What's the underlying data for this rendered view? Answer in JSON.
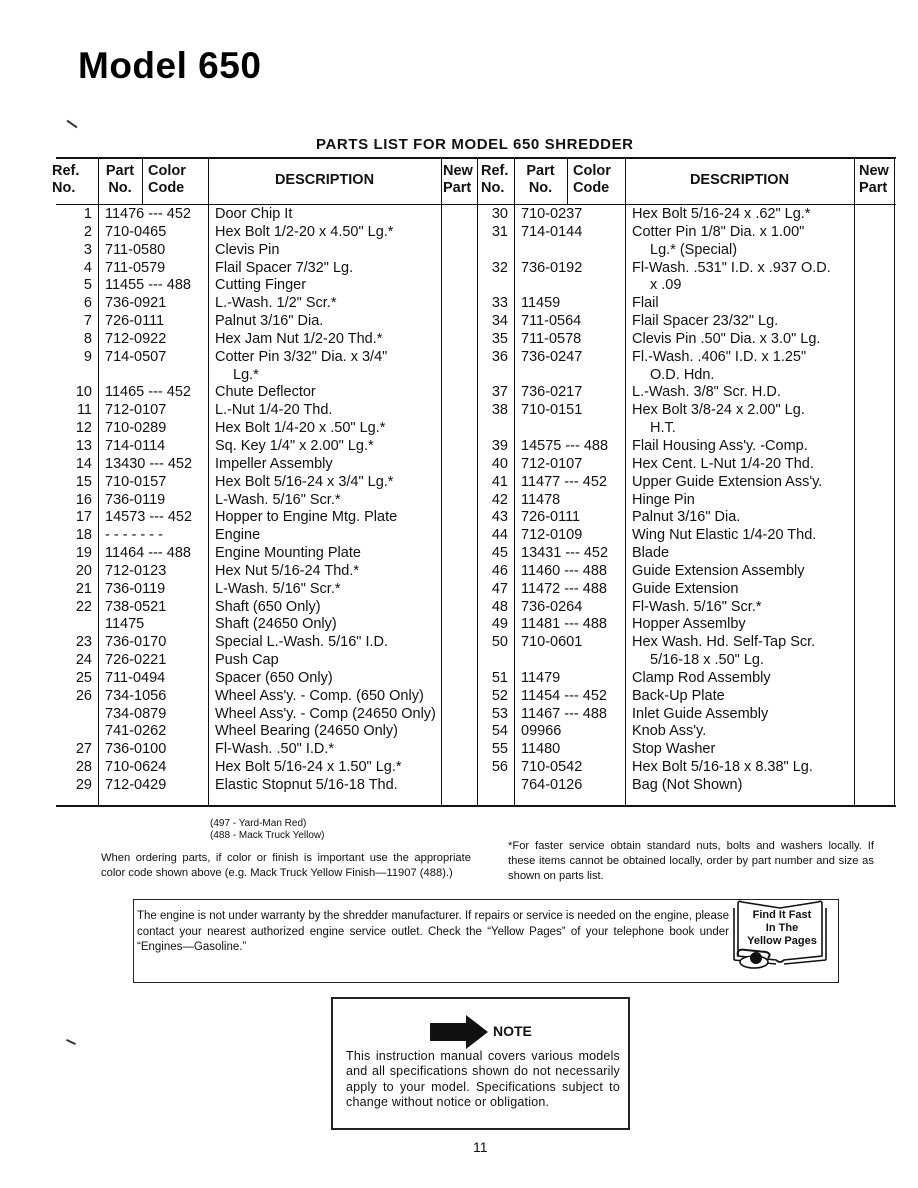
{
  "page": {
    "title": "Model 650",
    "parts_heading": "PARTS LIST FOR MODEL 650 SHREDDER",
    "page_number": "11"
  },
  "table": {
    "headers": {
      "ref": [
        "Ref.",
        "No."
      ],
      "part": [
        "Part",
        "No."
      ],
      "color": [
        "Color",
        "Code"
      ],
      "description": "DESCRIPTION",
      "new": [
        "New",
        "Part"
      ]
    },
    "left_rows": [
      {
        "ref": "1",
        "part": "11476 --- 452",
        "desc": "Door Chip It"
      },
      {
        "ref": "2",
        "part": "710-0465",
        "desc": "Hex Bolt 1/2-20 x 4.50\" Lg.*"
      },
      {
        "ref": "3",
        "part": "711-0580",
        "desc": "Clevis Pin"
      },
      {
        "ref": "4",
        "part": "711-0579",
        "desc": "Flail Spacer 7/32\" Lg."
      },
      {
        "ref": "5",
        "part": "11455 --- 488",
        "desc": "Cutting Finger"
      },
      {
        "ref": "6",
        "part": "736-0921",
        "desc": "L.-Wash. 1/2\" Scr.*"
      },
      {
        "ref": "7",
        "part": "726-0111",
        "desc": "Palnut 3/16\" Dia."
      },
      {
        "ref": "8",
        "part": "712-0922",
        "desc": "Hex Jam Nut 1/2-20 Thd.*"
      },
      {
        "ref": "9",
        "part": "714-0507",
        "desc": "Cotter Pin 3/32\" Dia. x 3/4\""
      },
      {
        "ref": "",
        "part": "",
        "desc": "Lg.*",
        "cont": true
      },
      {
        "ref": "10",
        "part": "11465 --- 452",
        "desc": "Chute Deflector"
      },
      {
        "ref": "11",
        "part": "712-0107",
        "desc": "L.-Nut 1/4-20 Thd."
      },
      {
        "ref": "12",
        "part": "710-0289",
        "desc": "Hex Bolt 1/4-20 x .50\" Lg.*"
      },
      {
        "ref": "13",
        "part": "714-0114",
        "desc": "Sq. Key 1/4\" x 2.00\" Lg.*"
      },
      {
        "ref": "14",
        "part": "13430 --- 452",
        "desc": "Impeller Assembly"
      },
      {
        "ref": "15",
        "part": "710-0157",
        "desc": "Hex Bolt 5/16-24 x 3/4\" Lg.*"
      },
      {
        "ref": "16",
        "part": "736-0119",
        "desc": "L-Wash. 5/16\" Scr.*"
      },
      {
        "ref": "17",
        "part": "14573 --- 452",
        "desc": "Hopper to Engine Mtg. Plate"
      },
      {
        "ref": "18",
        "part": "- - - - - - -",
        "desc": "Engine"
      },
      {
        "ref": "19",
        "part": "11464 --- 488",
        "desc": "Engine Mounting Plate"
      },
      {
        "ref": "20",
        "part": "712-0123",
        "desc": "Hex Nut 5/16-24 Thd.*"
      },
      {
        "ref": "21",
        "part": "736-0119",
        "desc": "L-Wash. 5/16\" Scr.*"
      },
      {
        "ref": "22",
        "part": "738-0521",
        "desc": "Shaft (650 Only)"
      },
      {
        "ref": "",
        "part": "11475",
        "desc": "Shaft (24650 Only)"
      },
      {
        "ref": "23",
        "part": "736-0170",
        "desc": "Special L.-Wash. 5/16\" I.D."
      },
      {
        "ref": "24",
        "part": "726-0221",
        "desc": "Push Cap"
      },
      {
        "ref": "25",
        "part": "711-0494",
        "desc": "Spacer (650 Only)"
      },
      {
        "ref": "26",
        "part": "734-1056",
        "desc": "Wheel Ass'y. - Comp. (650 Only)"
      },
      {
        "ref": "",
        "part": "734-0879",
        "desc": "Wheel Ass'y. - Comp (24650 Only)"
      },
      {
        "ref": "",
        "part": "741-0262",
        "desc": "Wheel Bearing (24650 Only)"
      },
      {
        "ref": "27",
        "part": "736-0100",
        "desc": "Fl-Wash. .50\" I.D.*"
      },
      {
        "ref": "28",
        "part": "710-0624",
        "desc": "Hex Bolt  5/16-24 x 1.50\" Lg.*"
      },
      {
        "ref": "29",
        "part": "712-0429",
        "desc": "Elastic Stopnut 5/16-18 Thd."
      }
    ],
    "right_rows": [
      {
        "ref": "30",
        "part": "710-0237",
        "desc": "Hex Bolt 5/16-24 x .62\" Lg.*"
      },
      {
        "ref": "31",
        "part": "714-0144",
        "desc": "Cotter Pin 1/8\" Dia. x 1.00\""
      },
      {
        "ref": "",
        "part": "",
        "desc": "Lg.* (Special)",
        "cont": true
      },
      {
        "ref": "32",
        "part": "736-0192",
        "desc": "Fl-Wash. .531\" I.D. x .937 O.D."
      },
      {
        "ref": "",
        "part": "",
        "desc": "x .09",
        "cont": true
      },
      {
        "ref": "33",
        "part": "11459",
        "desc": "Flail"
      },
      {
        "ref": "34",
        "part": "711-0564",
        "desc": "Flail Spacer 23/32\" Lg."
      },
      {
        "ref": "35",
        "part": "711-0578",
        "desc": "Clevis Pin .50\" Dia. x 3.0\" Lg."
      },
      {
        "ref": "36",
        "part": "736-0247",
        "desc": "Fl.-Wash. .406\" I.D. x 1.25\""
      },
      {
        "ref": "",
        "part": "",
        "desc": "O.D. Hdn.",
        "cont": true
      },
      {
        "ref": "37",
        "part": "736-0217",
        "desc": "L.-Wash. 3/8\" Scr. H.D."
      },
      {
        "ref": "38",
        "part": "710-0151",
        "desc": "Hex Bolt 3/8-24 x 2.00\" Lg."
      },
      {
        "ref": "",
        "part": "",
        "desc": "H.T.",
        "cont": true
      },
      {
        "ref": "39",
        "part": "14575 --- 488",
        "desc": "Flail Housing Ass'y. -Comp."
      },
      {
        "ref": "40",
        "part": "712-0107",
        "desc": "Hex Cent. L-Nut 1/4-20 Thd."
      },
      {
        "ref": "41",
        "part": "11477 --- 452",
        "desc": "Upper Guide Extension Ass'y."
      },
      {
        "ref": "42",
        "part": "11478",
        "desc": "Hinge Pin"
      },
      {
        "ref": "43",
        "part": "726-0111",
        "desc": "Palnut 3/16\" Dia."
      },
      {
        "ref": "44",
        "part": "712-0109",
        "desc": "Wing Nut Elastic 1/4-20 Thd."
      },
      {
        "ref": "45",
        "part": "13431 --- 452",
        "desc": "Blade"
      },
      {
        "ref": "46",
        "part": "11460 --- 488",
        "desc": "Guide Extension Assembly"
      },
      {
        "ref": "47",
        "part": "11472 --- 488",
        "desc": "Guide Extension"
      },
      {
        "ref": "48",
        "part": "736-0264",
        "desc": "Fl-Wash. 5/16\" Scr.*"
      },
      {
        "ref": "49",
        "part": "11481 --- 488",
        "desc": "Hopper Assemlby"
      },
      {
        "ref": "50",
        "part": "710-0601",
        "desc": "Hex Wash. Hd. Self-Tap Scr."
      },
      {
        "ref": "",
        "part": "",
        "desc": "5/16-18 x .50\" Lg.",
        "cont": true
      },
      {
        "ref": "51",
        "part": "11479",
        "desc": "Clamp Rod Assembly"
      },
      {
        "ref": "52",
        "part": "11454 --- 452",
        "desc": "Back-Up Plate"
      },
      {
        "ref": "53",
        "part": "11467 --- 488",
        "desc": "Inlet Guide Assembly"
      },
      {
        "ref": "54",
        "part": "09966",
        "desc": "Knob Ass'y."
      },
      {
        "ref": "55",
        "part": "11480",
        "desc": "Stop Washer"
      },
      {
        "ref": "56",
        "part": "710-0542",
        "desc": "Hex Bolt 5/16-18 x 8.38\" Lg."
      },
      {
        "ref": "",
        "part": "764-0126",
        "desc": "Bag (Not Shown)"
      }
    ]
  },
  "notes": {
    "color_codes": [
      "(497 - Yard-Man Red)",
      "(488 - Mack Truck Yellow)"
    ],
    "ordering": "When ordering parts, if color or finish is important use the appropriate color code shown above (e.g. Mack Truck Yellow Finish—11907 (488).)",
    "faster_service": "*For faster service obtain standard nuts, bolts and washers locally. If these items cannot be obtained locally, order by part number and size as shown on parts list.",
    "engine_warranty": "The engine is not under warranty by the shredder manufacturer. If repairs or service is needed on the engine, please contact your nearest authorized engine service outlet. Check the “Yellow Pages” of your telephone book under “Engines—Gasoline.”",
    "yellow_pages_badge": [
      "Find It Fast",
      "In The",
      "Yellow Pages"
    ],
    "note_title": "NOTE",
    "note_text": "This instruction manual covers various models and all specifications shown do not necessarily apply to your model. Specifications subject to change without notice or obligation."
  }
}
